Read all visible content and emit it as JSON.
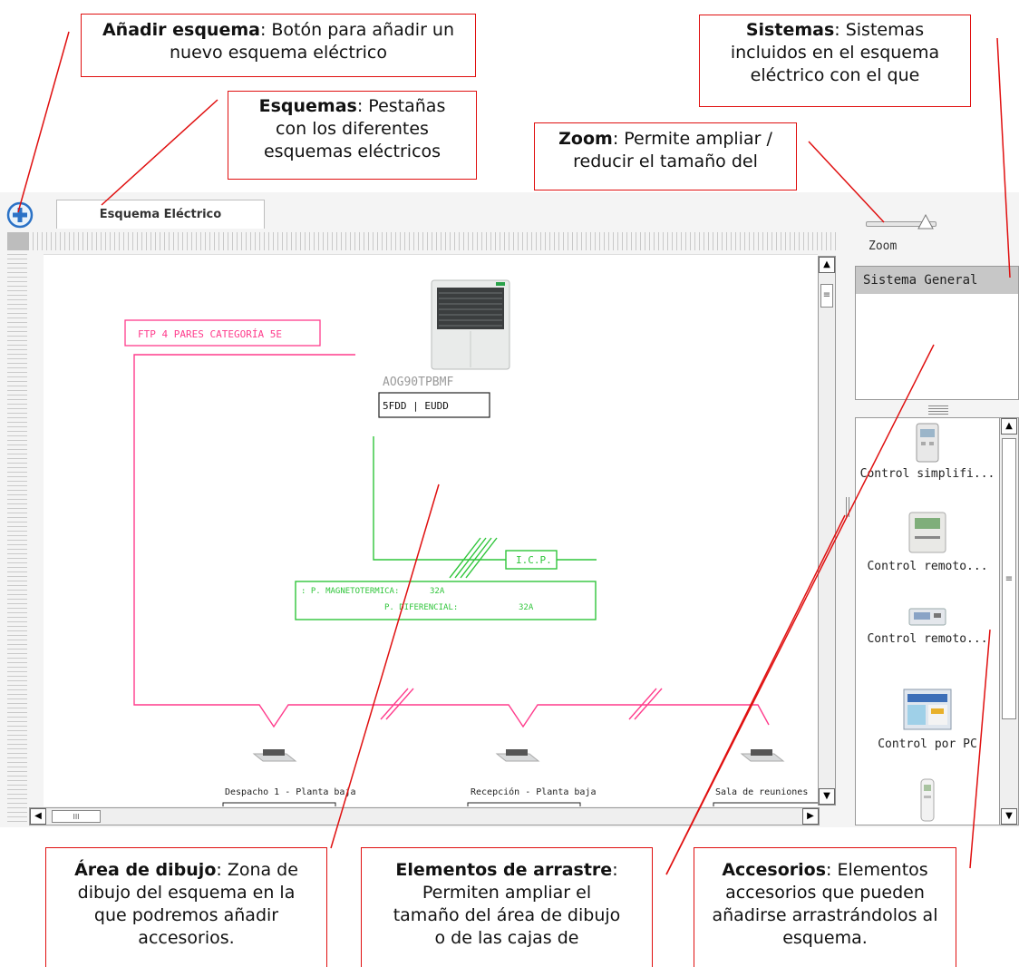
{
  "callouts": {
    "add_scheme": {
      "title": "Añadir esquema",
      "text": ": Botón para añadir un nuevo esquema eléctrico"
    },
    "schemes": {
      "title": "Esquemas",
      "text": ": Pestañas con los diferentes esquemas eléctricos"
    },
    "systems": {
      "title": "Sistemas",
      "text": ": Sistemas incluidos en el esquema eléctrico con el que"
    },
    "zoom": {
      "title": "Zoom",
      "text": ": Permite ampliar / reducir el tamaño del"
    },
    "drawing_area": {
      "title": "Área de dibujo",
      "text": ": Zona de dibujo del esquema en la que podremos añadir accesorios."
    },
    "drag_elements": {
      "title": "Elementos de arrastre",
      "text": ": Permiten ampliar el tamaño del área de dibujo o de las cajas de"
    },
    "accessories": {
      "title": "Accesorios",
      "text": ": Elementos accesorios que pueden añadirse arrastrándolos al esquema."
    }
  },
  "tab": {
    "label": "Esquema Eléctrico"
  },
  "zoom": {
    "label": "Zoom"
  },
  "systems": {
    "items": [
      "Sistema General"
    ]
  },
  "accessories": {
    "items": [
      "Control simplifi...",
      "Control remoto...",
      "Control remoto...",
      "Control por PC"
    ]
  },
  "diagram": {
    "cable_label": "FTP 4 PARES CATEGORÍA 5E",
    "unit_model": "AOG90TPBMF",
    "unit_code": "5FDD | EUDD",
    "icp_label": "I.C.P.",
    "protection_1_label": ": P. MAGNETOTERMICA:",
    "protection_1_value": "32A",
    "protection_2_label": "P. DIFERENCIAL:",
    "protection_2_value": "32A",
    "room_1": "Despacho 1 - Planta baja",
    "room_2": "Recepción - Planta baja",
    "room_3": "Sala de reuniones"
  },
  "scroll": {
    "hthumb": "III",
    "vthumb": "≡"
  },
  "colors": {
    "callout_border": "#e01010",
    "network_line": "#ff3c8c",
    "power_line": "#2fc53a"
  }
}
